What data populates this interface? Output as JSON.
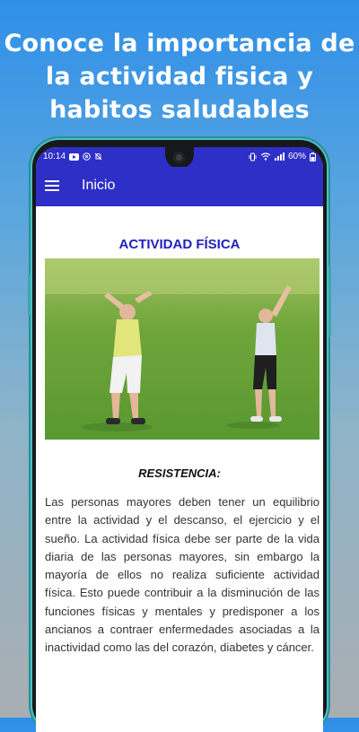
{
  "promo": {
    "title": "Conoce la importancia de la actividad fisica y habitos saludables"
  },
  "status_bar": {
    "time": "10:14",
    "battery": "60%"
  },
  "app_bar": {
    "title": "Inicio",
    "menu_icon": "hamburger-menu-icon"
  },
  "content": {
    "section_title": "ACTIVIDAD FÍSICA",
    "subtitle": "RESISTENCIA:",
    "body": "Las personas mayores deben tener un equilibrio entre la actividad y el descanso, el ejercicio y el sueño. La actividad física debe ser parte de la vida diaria de las personas mayores, sin embargo la mayoría de ellos no realiza suficiente actividad física. Esto puede contribuir a la disminución de las funciones físicas y mentales y predisponer a los ancianos a contraer enfermedades asociadas a la inactividad como las del corazón, diabetes y cáncer."
  },
  "colors": {
    "app_bar": "#2e2fc7",
    "section_title": "#2020c0",
    "phone_frame_accent": "#4bc0c4"
  }
}
